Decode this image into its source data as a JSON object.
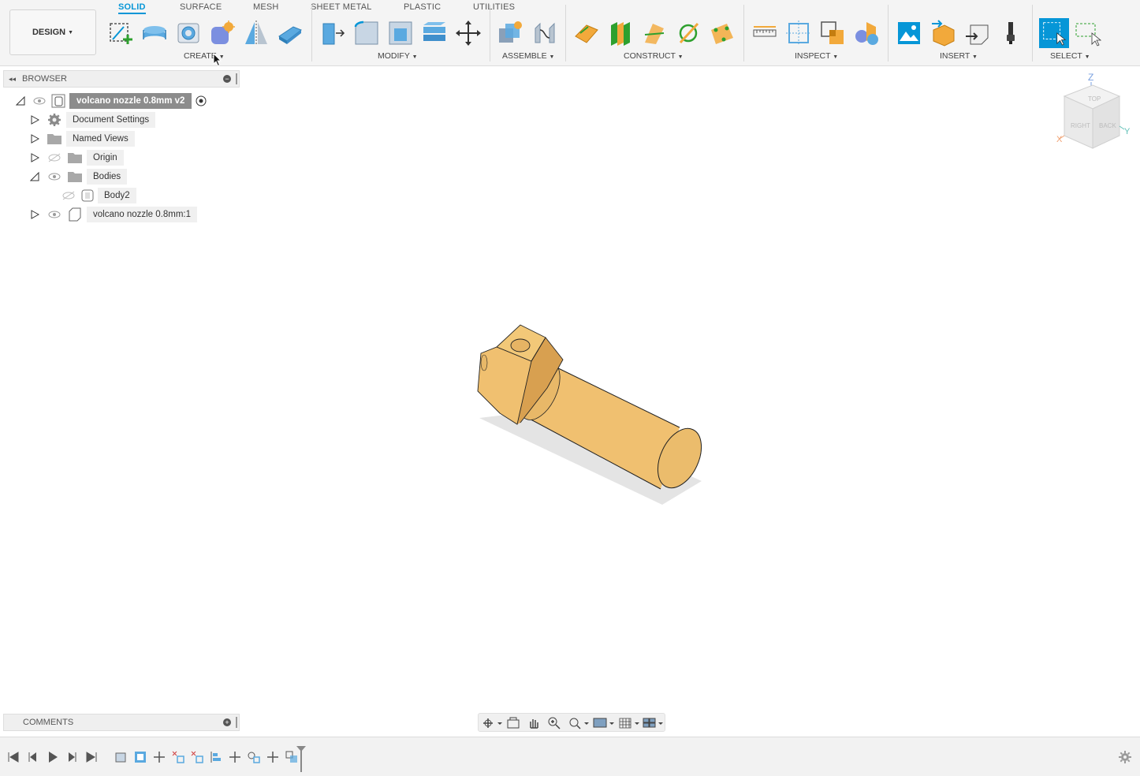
{
  "workspace": {
    "label": "DESIGN"
  },
  "tabs": [
    {
      "label": "SOLID",
      "active": true
    },
    {
      "label": "SURFACE"
    },
    {
      "label": "MESH"
    },
    {
      "label": "SHEET METAL"
    },
    {
      "label": "PLASTIC"
    },
    {
      "label": "UTILITIES"
    }
  ],
  "groups": {
    "create": "CREATE",
    "modify": "MODIFY",
    "assemble": "ASSEMBLE",
    "construct": "CONSTRUCT",
    "inspect": "INSPECT",
    "insert": "INSERT",
    "select": "SELECT"
  },
  "browser": {
    "title": "BROWSER",
    "root": "volcano nozzle 0.8mm v2",
    "items": [
      {
        "label": "Document Settings",
        "icon": "gear-icon"
      },
      {
        "label": "Named Views",
        "icon": "folder-icon"
      },
      {
        "label": "Origin",
        "icon": "folder-icon",
        "hidden": true
      },
      {
        "label": "Bodies",
        "icon": "folder-icon",
        "expanded": true
      },
      {
        "label": "Body2",
        "icon": "body-icon",
        "hidden": true
      },
      {
        "label": "volcano nozzle 0.8mm:1",
        "icon": "component-icon"
      }
    ]
  },
  "comments": {
    "title": "COMMENTS"
  },
  "viewcube": {
    "z": "Z",
    "x": "X",
    "y": "Y",
    "top": "TOP",
    "right": "RIGHT",
    "back": "BACK"
  },
  "colors": {
    "accent": "#0696d7",
    "body": "#f0c070",
    "body_dark": "#d8a858"
  }
}
